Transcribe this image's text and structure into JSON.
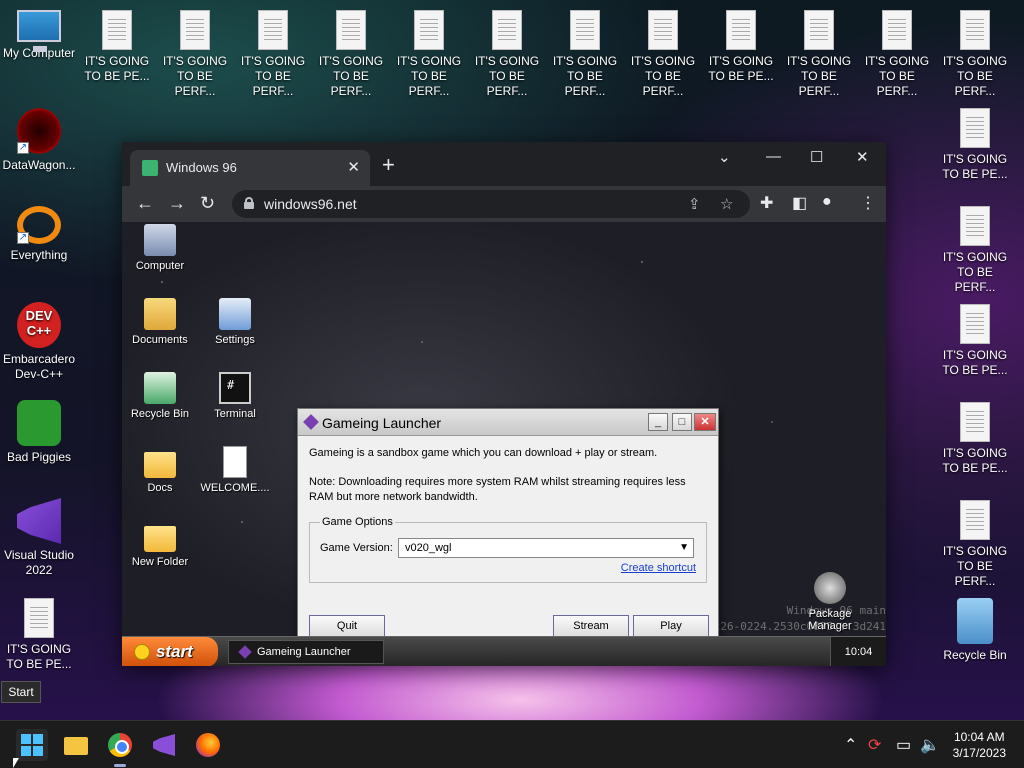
{
  "host_desktop": {
    "icons": [
      {
        "label": "My Computer"
      },
      {
        "label": "DataWagon..."
      },
      {
        "label": "Everything"
      },
      {
        "label": "Embarcadero Dev-C++"
      },
      {
        "label": "Bad Piggies"
      },
      {
        "label": "Visual Studio 2022"
      },
      {
        "label": "Recycle Bin"
      }
    ],
    "doc_label_line1": "IT'S GOING",
    "doc_label_line2": "TO BE PERF...",
    "doc_label_line2_short": "TO BE PE...",
    "dev_icon_text": "DEV C++",
    "start_tooltip": "Start"
  },
  "host_taskbar": {
    "time": "10:04 AM",
    "date": "3/17/2023"
  },
  "browser": {
    "tab_title": "Windows 96",
    "url": "windows96.net",
    "new_tab_glyph": "+",
    "close_glyph": "✕"
  },
  "win96": {
    "desktop_icons": [
      {
        "label": "Computer"
      },
      {
        "label": "Documents"
      },
      {
        "label": "Settings"
      },
      {
        "label": "Recycle Bin"
      },
      {
        "label": "Terminal"
      },
      {
        "label": "Docs"
      },
      {
        "label": "WELCOME...."
      },
      {
        "label": "New Folder"
      },
      {
        "label": "Package Manager"
      }
    ],
    "watermark_line1": "Windows 96 main",
    "watermark_line2": "Build 12768.7b9e0ede.230226-0224.2530c0875...3d241",
    "dialog": {
      "title": "Gameing Launcher",
      "description": "Gameing is a sandbox game which you can download + play or stream.",
      "note": "Note: Downloading requires more system RAM whilst streaming requires less RAM but more network bandwidth.",
      "group_label": "Game Options",
      "version_label": "Game Version:",
      "version_value": "v020_wgl",
      "create_shortcut": "Create shortcut",
      "quit": "Quit",
      "stream": "Stream",
      "play": "Play"
    },
    "taskbar": {
      "start_label": "start",
      "task_label": "Gameing Launcher",
      "clock": "10:04"
    }
  }
}
